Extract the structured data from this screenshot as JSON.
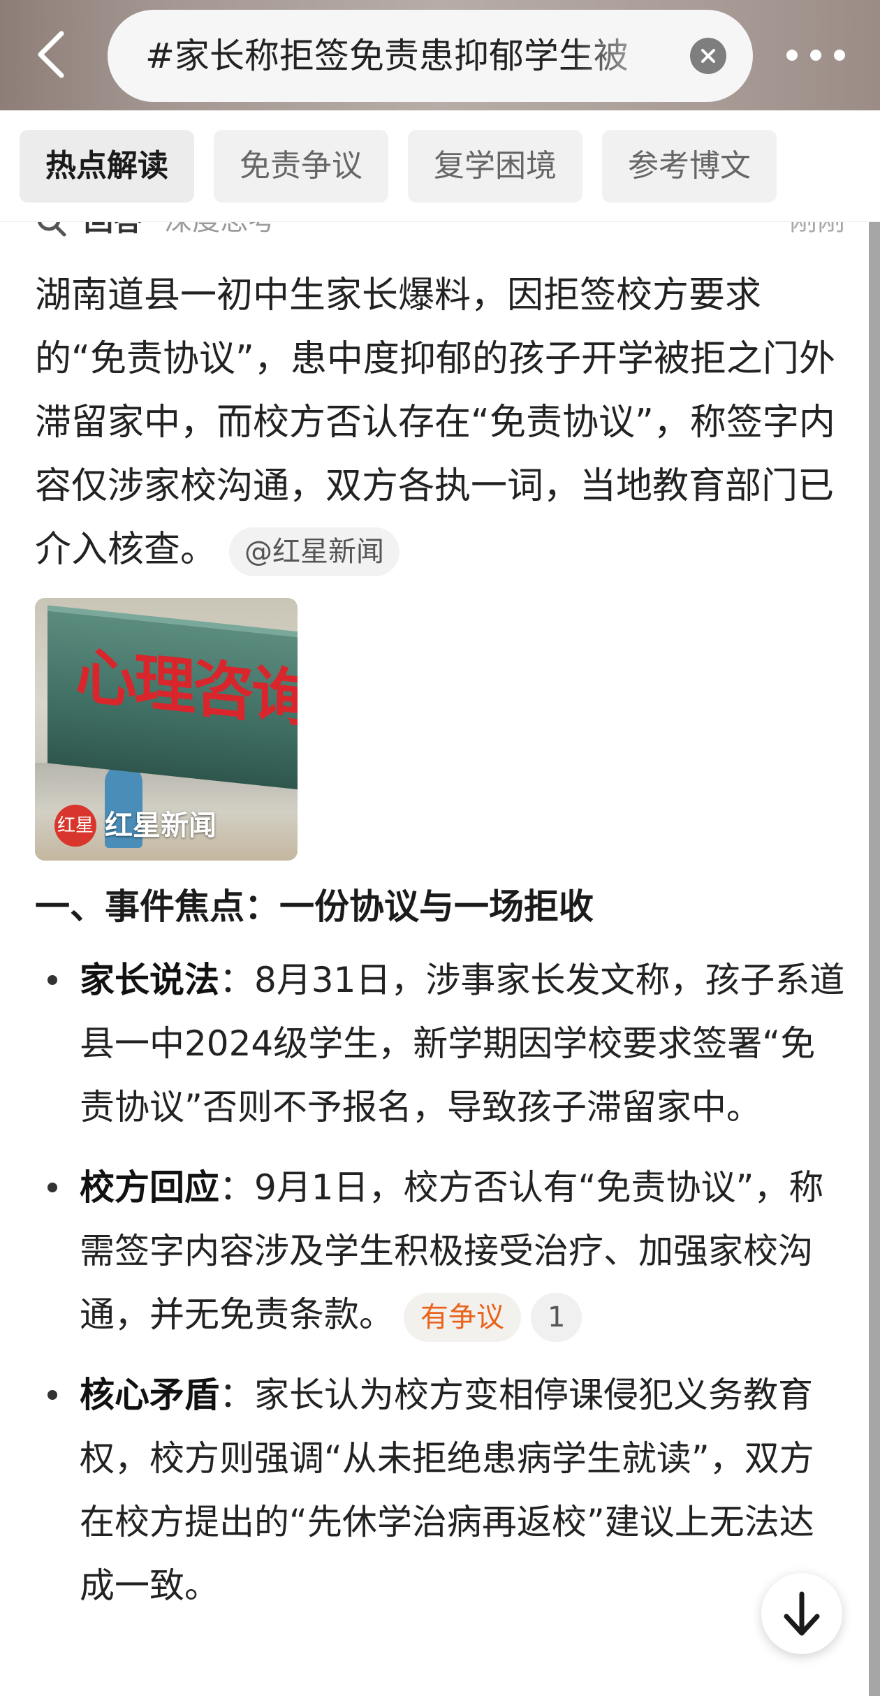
{
  "header": {
    "search_query": "#家长称拒签免责患抑郁学生被",
    "clear_icon": "close-circle-icon",
    "back_icon": "chevron-left-icon",
    "more_icon": "more-dots-icon"
  },
  "tabs": [
    {
      "label": "热点解读",
      "active": true
    },
    {
      "label": "免责争议",
      "active": false
    },
    {
      "label": "复学困境",
      "active": false
    },
    {
      "label": "参考博文",
      "active": false
    }
  ],
  "answer_meta": {
    "label": "回答",
    "mode": "· 深度思考",
    "time": "刚刚"
  },
  "lead_text": "湖南道县一初中生家长爆料，因拒签校方要求的“免责协议”，患中度抑郁的孩子开学被拒之门外滞留家中，而校方否认存在“免责协议”，称签字内容仅涉家校沟通，双方各执一词，当地教育部门已介入核查。",
  "source_chip": "@红星新闻",
  "image_card": {
    "sign_text": "心理咨询室",
    "source_logo_text": "红星",
    "source_name": "红星新闻"
  },
  "section_heading": "一、事件焦点：一份协议与一场拒收",
  "bullets": [
    {
      "title": "家长说法",
      "text": "：8月31日，涉事家长发文称，孩子系道县一中2024级学生，新学期因学校要求签署“免责协议”否则不予报名，导致孩子滞留家中。"
    },
    {
      "title": "校方回应",
      "text": "：9月1日，校方否认有“免责协议”，称需签字内容涉及学生积极接受治疗、加强家校沟通，并无免责条款。",
      "tag": "有争议",
      "ref_count": "1"
    },
    {
      "title": "核心矛盾",
      "text": "：家长认为校方变相停课侵犯义务教育权，校方则强调“从未拒绝患病学生就读”，双方在校方提出的“先休学治病再返校”建议上无法达成一致。"
    }
  ],
  "fab_icon": "arrow-down-icon",
  "colors": {
    "dispute_tag": "#e8641e",
    "header_bg": "#a59893"
  }
}
